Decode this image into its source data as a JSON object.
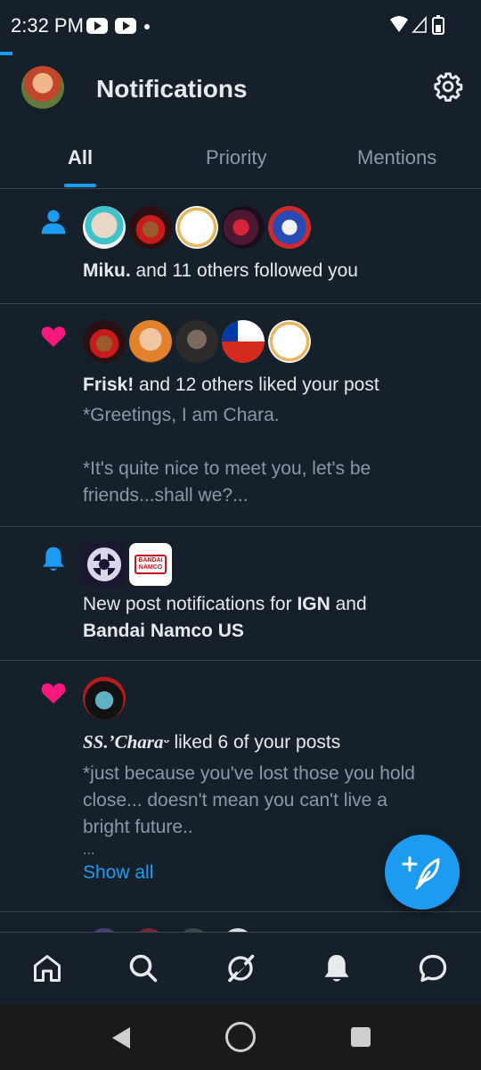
{
  "status_bar": {
    "time": "2:32 PM"
  },
  "header": {
    "title": "Notifications"
  },
  "tabs": [
    {
      "label": "All",
      "active": true
    },
    {
      "label": "Priority",
      "active": false
    },
    {
      "label": "Mentions",
      "active": false
    }
  ],
  "notifications": [
    {
      "type": "follow",
      "icon": "person-icon",
      "bold_name": "Miku.",
      "text": " and 11 others followed you"
    },
    {
      "type": "like",
      "icon": "heart-icon",
      "bold_name": "Frisk!",
      "text": " and 12 others liked your post",
      "preview_line1": "*Greetings, I am Chara.",
      "preview_line2": "*It's quite nice to meet you, let's be",
      "preview_line3": "friends...shall we?..."
    },
    {
      "type": "post-notification",
      "icon": "bell-icon",
      "text_prefix": "New post notifications for ",
      "bold_name1": "IGN",
      "text_mid": " and",
      "bold_name2": "Bandai Namco US",
      "logo_text": "BANDAI NAMCO"
    },
    {
      "type": "like",
      "icon": "heart-icon",
      "bold_name": "SS.’Charaᵕ",
      "text": " liked 6 of your posts",
      "preview_line1": "*just because you've lost those you hold",
      "preview_line2": "close... doesn't mean you can't live a",
      "preview_line3": "bright future..",
      "preview_line4": "...",
      "show_all": "Show all"
    }
  ],
  "colors": {
    "accent": "#1d9bf0",
    "like": "#f91880",
    "background": "#15202b"
  }
}
